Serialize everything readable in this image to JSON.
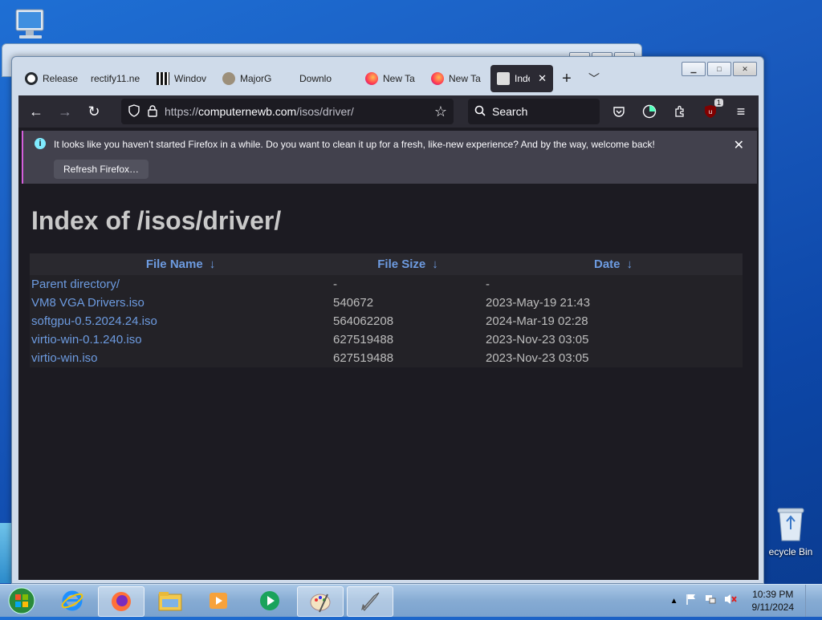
{
  "desktop": {
    "recycle_bin_label": "ecycle Bin"
  },
  "browser": {
    "tabs": [
      {
        "label": "Release",
        "icon": "github-icon"
      },
      {
        "label": "rectify11.ne",
        "icon": "blank-icon"
      },
      {
        "label": "Windov",
        "icon": "columns-icon"
      },
      {
        "label": "MajorG",
        "icon": "major-geeks-icon"
      },
      {
        "label": "Downlo",
        "icon": "blank-icon"
      },
      {
        "label": "New Ta",
        "icon": "firefox-icon"
      },
      {
        "label": "New Ta",
        "icon": "firefox-icon"
      },
      {
        "label": "Inde",
        "icon": "server-icon",
        "active": true
      }
    ],
    "url_prefix": "https://",
    "url_host": "computernewb.com",
    "url_path": "/isos/driver/",
    "search_placeholder": "Search",
    "extension_badge": "1"
  },
  "notification": {
    "message": "It looks like you haven’t started Firefox in a while. Do you want to clean it up for a fresh, like-new experience? And by the way, welcome back!",
    "button": "Refresh Firefox…"
  },
  "page": {
    "title": "Index of /isos/driver/",
    "columns": [
      "File Name",
      "File Size",
      "Date"
    ],
    "sort_arrow": "↓",
    "rows": [
      {
        "name": "Parent directory/",
        "size": "-",
        "date": "-"
      },
      {
        "name": "VM8 VGA Drivers.iso",
        "size": "540672",
        "date": "2023-May-19 21:43"
      },
      {
        "name": "softgpu-0.5.2024.24.iso",
        "size": "564062208",
        "date": "2024-Mar-19 02:28"
      },
      {
        "name": "virtio-win-0.1.240.iso",
        "size": "627519488",
        "date": "2023-Nov-23 03:05"
      },
      {
        "name": "virtio-win.iso",
        "size": "627519488",
        "date": "2023-Nov-23 03:05"
      }
    ]
  },
  "taskbar": {
    "time": "10:39 PM",
    "date": "9/11/2024"
  },
  "colors": {
    "accent_link": "#6d9be0",
    "toolbar_bg": "#2b2a33",
    "content_bg": "#1c1b22"
  }
}
